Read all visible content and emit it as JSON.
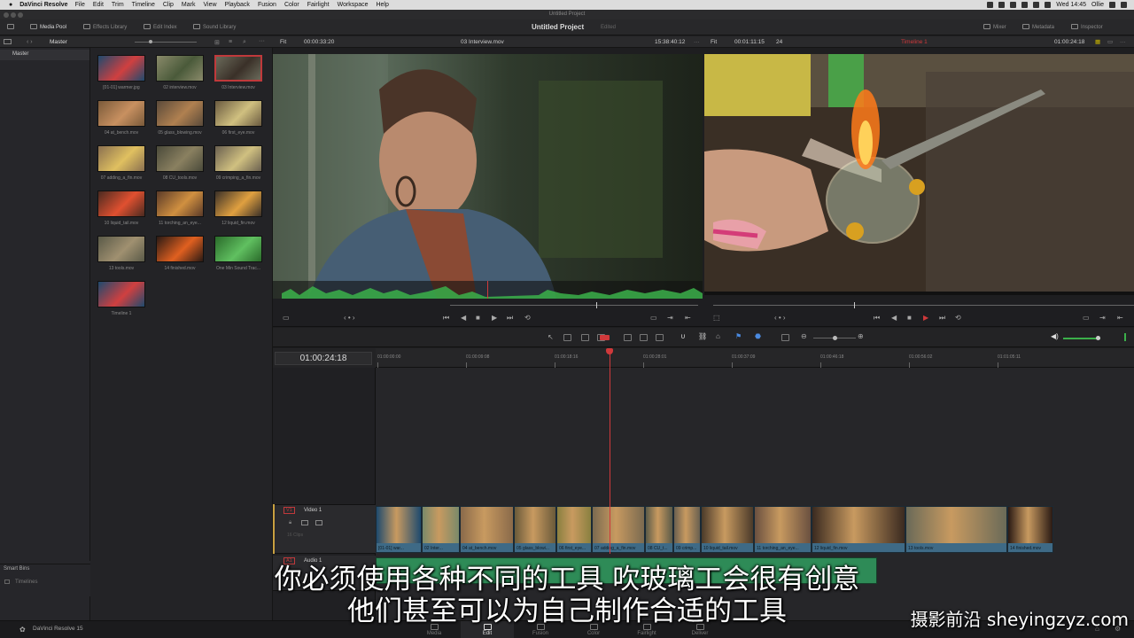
{
  "menubar": {
    "app": "DaVinci Resolve",
    "items": [
      "File",
      "Edit",
      "Trim",
      "Timeline",
      "Clip",
      "Mark",
      "View",
      "Playback",
      "Fusion",
      "Color",
      "Fairlight",
      "Workspace",
      "Help"
    ],
    "clock": "Wed 14:45",
    "user": "Ollie"
  },
  "window": {
    "title": "Untitled Project"
  },
  "toolbar": {
    "media_pool": "Media Pool",
    "effects_library": "Effects Library",
    "edit_index": "Edit Index",
    "sound_library": "Sound Library",
    "project_title": "Untitled Project",
    "project_status": "Edited",
    "mixer": "Mixer",
    "metadata": "Metadata",
    "inspector": "Inspector"
  },
  "bins": {
    "master_header": "Master",
    "master_item": "Master",
    "smart_bins": "Smart Bins",
    "timelines": "Timelines"
  },
  "media_pool": {
    "clips": [
      {
        "name": "[01-01] warmer.jpg"
      },
      {
        "name": "02 interview.mov"
      },
      {
        "name": "03 Interview.mov",
        "selected": true
      },
      {
        "name": "04 at_bench.mov"
      },
      {
        "name": "05 glass_blowing.mov"
      },
      {
        "name": "06 first_eye.mov"
      },
      {
        "name": "07 adding_a_fin.mov"
      },
      {
        "name": "08 CU_tools.mov"
      },
      {
        "name": "09 crimping_a_fin.mov"
      },
      {
        "name": "10 liquid_tail.mov"
      },
      {
        "name": "11 torching_an_eye..."
      },
      {
        "name": "12 liquid_fin.mov"
      },
      {
        "name": "13 tools.mov"
      },
      {
        "name": "14 finished.mov"
      },
      {
        "name": "One Min Sound Trac..."
      },
      {
        "name": "Timeline 1"
      }
    ]
  },
  "source_viewer": {
    "zoom": "Fit",
    "duration": "00:00:33:20",
    "clip_name": "03 Interview.mov",
    "timecode": "15:38:40:12"
  },
  "program_viewer": {
    "zoom": "Fit",
    "duration": "00:01:11:15",
    "fps": "24",
    "timeline_name": "Timeline 1",
    "timecode": "01:00:24:18"
  },
  "timeline": {
    "current_timecode": "01:00:24:18",
    "ruler": [
      "01:00:00:00",
      "01:00:09:08",
      "01:00:18:16",
      "01:00:28:01",
      "01:00:37:09",
      "01:00:46:18",
      "01:00:56:02",
      "01:01:05:11"
    ],
    "video_track": {
      "id": "V1",
      "name": "Video 1",
      "clip_count": "16 Clips"
    },
    "audio_track": {
      "id": "A1",
      "name": "Audio 1"
    },
    "clips": [
      "[01-01] war...",
      "02 Inter...",
      "04 at_bench.mov",
      "05 glass_blowi...",
      "06 first_eye...",
      "07 adding_a_fin.mov",
      "08 CU_t...",
      "09 crimp...",
      "10 liquid_tail.mov",
      "11 torching_an_eye...",
      "12 liquid_fin.mov",
      "13 tools.mov",
      "14 finished.mov"
    ]
  },
  "pagenav": {
    "app_label": "DaVinci Resolve 15",
    "pages": [
      "Media",
      "Edit",
      "Fusion",
      "Color",
      "Fairlight",
      "Deliver"
    ],
    "active": "Edit"
  },
  "subtitles": {
    "line1": "你必须使用各种不同的工具  吹玻璃工会很有创意",
    "line2": "他们甚至可以为自己制作合适的工具"
  },
  "watermark": "摄影前沿 sheyingzyz.com",
  "colors": {
    "accent_red": "#d0393b",
    "clip_blue": "#3e6a86",
    "audio_green": "#2e8b57"
  }
}
